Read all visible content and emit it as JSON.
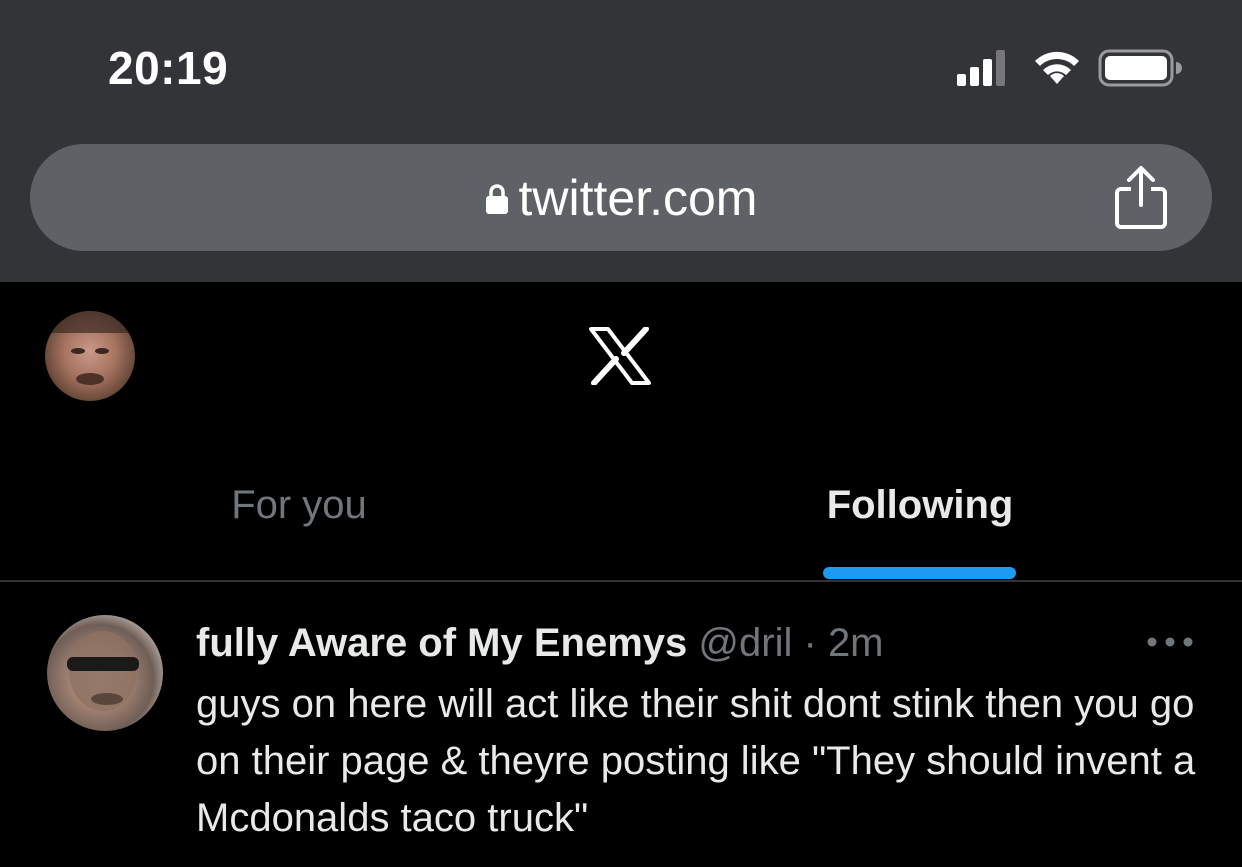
{
  "status_bar": {
    "time": "20:19",
    "icons": [
      "cellular-signal-icon",
      "wifi-icon",
      "battery-icon"
    ]
  },
  "browser": {
    "url": "twitter.com",
    "icons": [
      "lock-icon",
      "share-icon"
    ]
  },
  "header": {
    "logo_icon": "x-logo-icon"
  },
  "tabs": [
    {
      "label": "For you",
      "active": false
    },
    {
      "label": "Following",
      "active": true
    }
  ],
  "tweet": {
    "display_name": "fully Aware of My Enemys",
    "handle": "@dril",
    "separator": "·",
    "time": "2m",
    "text": "guys on here will act like their shit dont stink then you go on their page & theyre posting like \"They should invent a Mcdonalds taco truck\"",
    "more_icon": "more-dots-icon"
  },
  "colors": {
    "chrome_bg": "#333437",
    "urlbar_bg": "#5e6166",
    "page_bg": "#000000",
    "accent": "#1d9bf0",
    "muted_text": "#71767b",
    "primary_text": "#e7e9ea"
  }
}
